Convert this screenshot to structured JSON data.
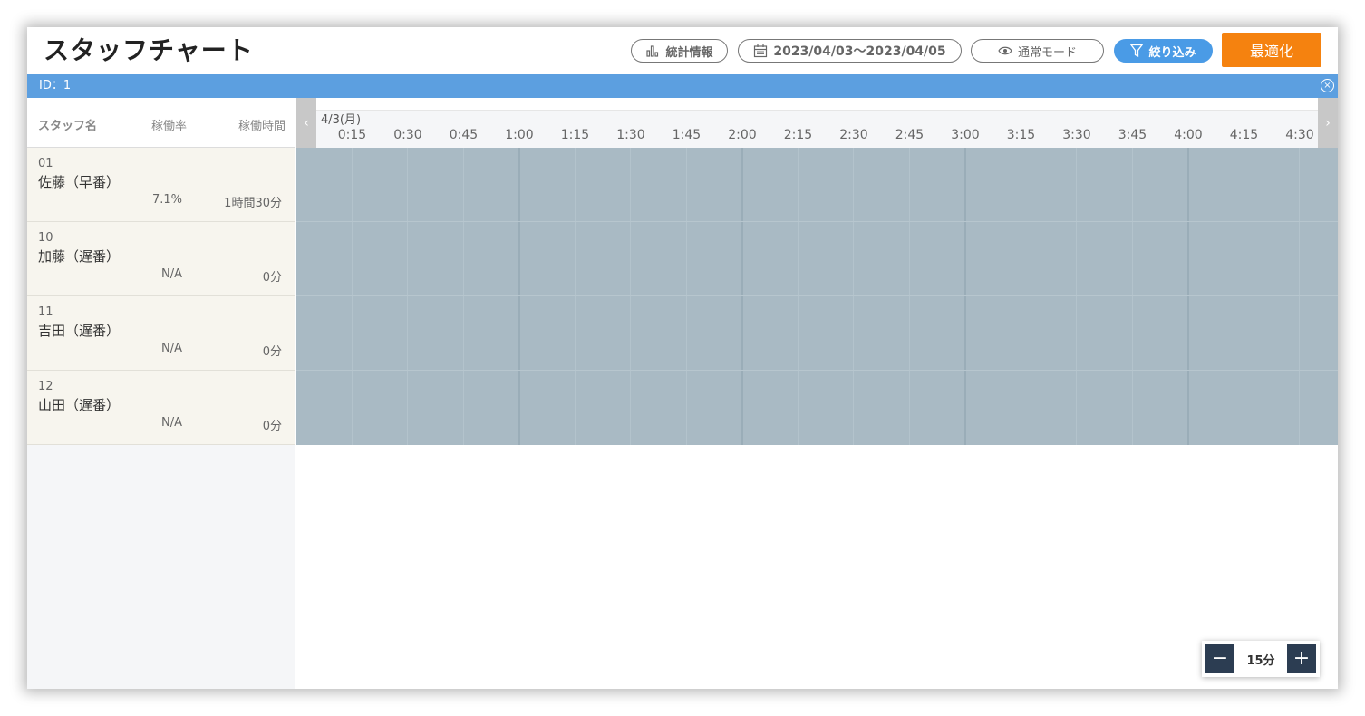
{
  "header": {
    "title": "スタッフチャート",
    "stats_label": "統計情報",
    "date_range": "2023/04/03〜2023/04/05",
    "mode_label": "通常モード",
    "filter_label": "絞り込み",
    "optimize_label": "最適化"
  },
  "id_bar": {
    "text": "ID：1",
    "close_icon": "close-circle-icon"
  },
  "staff_table": {
    "headers": {
      "name": "スタッフ名",
      "rate": "稼働率",
      "time": "稼働時間"
    },
    "rows": [
      {
        "id": "01",
        "name": "佐藤（早番）",
        "rate": "7.1%",
        "time": "1時間30分"
      },
      {
        "id": "10",
        "name": "加藤（遅番）",
        "rate": "N/A",
        "time": "0分"
      },
      {
        "id": "11",
        "name": "吉田（遅番）",
        "rate": "N/A",
        "time": "0分"
      },
      {
        "id": "12",
        "name": "山田（遅番）",
        "rate": "N/A",
        "time": "0分"
      }
    ]
  },
  "timeline": {
    "date_label": "4/3(月)",
    "ticks": [
      "0:15",
      "0:30",
      "0:45",
      "1:00",
      "1:15",
      "1:30",
      "1:45",
      "2:00",
      "2:15",
      "2:30",
      "2:45",
      "3:00",
      "3:15",
      "3:30",
      "3:45",
      "4:00",
      "4:15",
      "4:30"
    ],
    "prev_icon": "chevron-left-icon",
    "next_icon": "chevron-right-icon"
  },
  "zoom": {
    "value": "15分",
    "minus": "−",
    "plus": "+"
  },
  "colors": {
    "accent_blue": "#4a9be6",
    "id_bar": "#5c9fe0",
    "optimize": "#f5820f",
    "grid_fill": "#a9bac4",
    "zoom_button": "#2c3d52"
  }
}
